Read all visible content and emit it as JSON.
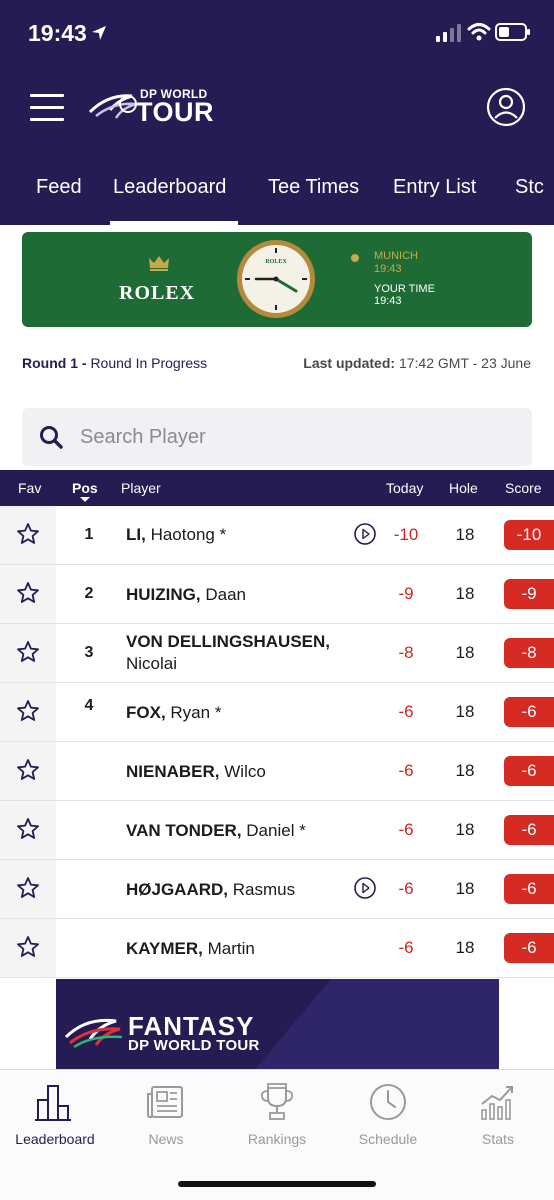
{
  "status_bar": {
    "time": "19:43"
  },
  "header": {
    "logo_top": "DP WORLD",
    "logo_bottom": "TOUR",
    "tabs": [
      {
        "label": "Feed",
        "active": false
      },
      {
        "label": "Leaderboard",
        "active": true
      },
      {
        "label": "Tee Times",
        "active": false
      },
      {
        "label": "Entry List",
        "active": false
      },
      {
        "label": "Stc",
        "active": false
      }
    ]
  },
  "rolex_banner": {
    "brand": "ROLEX",
    "city_label": "MUNICH",
    "city_time": "19:43",
    "your_time_label": "YOUR TIME",
    "your_time": "19:43"
  },
  "round": {
    "label": "Round 1 -",
    "status": "Round In Progress",
    "updated_label": "Last updated:",
    "updated_value": "17:42 GMT - 23 June"
  },
  "search": {
    "placeholder": "Search Player"
  },
  "table": {
    "columns": {
      "fav": "Fav",
      "pos": "Pos",
      "player": "Player",
      "today": "Today",
      "hole": "Hole",
      "score": "Score"
    },
    "rows": [
      {
        "pos": "1",
        "last": "LI,",
        "first": "Haotong",
        "marker": " *",
        "first_line2": "",
        "has_video": true,
        "today": "-10",
        "hole": "18",
        "score": "-10"
      },
      {
        "pos": "2",
        "last": "HUIZING,",
        "first": "Daan",
        "marker": "",
        "first_line2": "",
        "has_video": false,
        "today": "-9",
        "hole": "18",
        "score": "-9"
      },
      {
        "pos": "3",
        "last": "VON DELLINGSHAUSEN,",
        "first": "",
        "marker": "",
        "first_line2": "Nicolai",
        "has_video": false,
        "today": "-8",
        "hole": "18",
        "score": "-8"
      },
      {
        "pos": "4",
        "last": "FOX,",
        "first": "Ryan",
        "marker": " *",
        "first_line2": "",
        "has_video": false,
        "today": "-6",
        "hole": "18",
        "score": "-6"
      },
      {
        "pos": "",
        "last": "NIENABER,",
        "first": "Wilco",
        "marker": "",
        "first_line2": "",
        "has_video": false,
        "today": "-6",
        "hole": "18",
        "score": "-6"
      },
      {
        "pos": "",
        "last": "VAN TONDER,",
        "first": "Daniel",
        "marker": " *",
        "first_line2": "",
        "has_video": false,
        "today": "-6",
        "hole": "18",
        "score": "-6"
      },
      {
        "pos": "",
        "last": "HØJGAARD,",
        "first": "Rasmus",
        "marker": "",
        "first_line2": "",
        "has_video": true,
        "today": "-6",
        "hole": "18",
        "score": "-6"
      },
      {
        "pos": "",
        "last": "KAYMER,",
        "first": "Martin",
        "marker": "",
        "first_line2": "",
        "has_video": false,
        "today": "-6",
        "hole": "18",
        "score": "-6"
      }
    ]
  },
  "fantasy_banner": {
    "title": "FANTASY",
    "subtitle": "DP WORLD TOUR"
  },
  "bottom_nav": [
    {
      "label": "Leaderboard",
      "icon": "leaderboard-icon",
      "active": true
    },
    {
      "label": "News",
      "icon": "news-icon",
      "active": false
    },
    {
      "label": "Rankings",
      "icon": "trophy-icon",
      "active": false
    },
    {
      "label": "Schedule",
      "icon": "clock-icon",
      "active": false
    },
    {
      "label": "Stats",
      "icon": "stats-icon",
      "active": false
    }
  ],
  "colors": {
    "brand_navy": "#241c52",
    "score_red": "#d52b23",
    "rolex_green": "#1f6b35",
    "rolex_gold": "#c9a84a"
  }
}
